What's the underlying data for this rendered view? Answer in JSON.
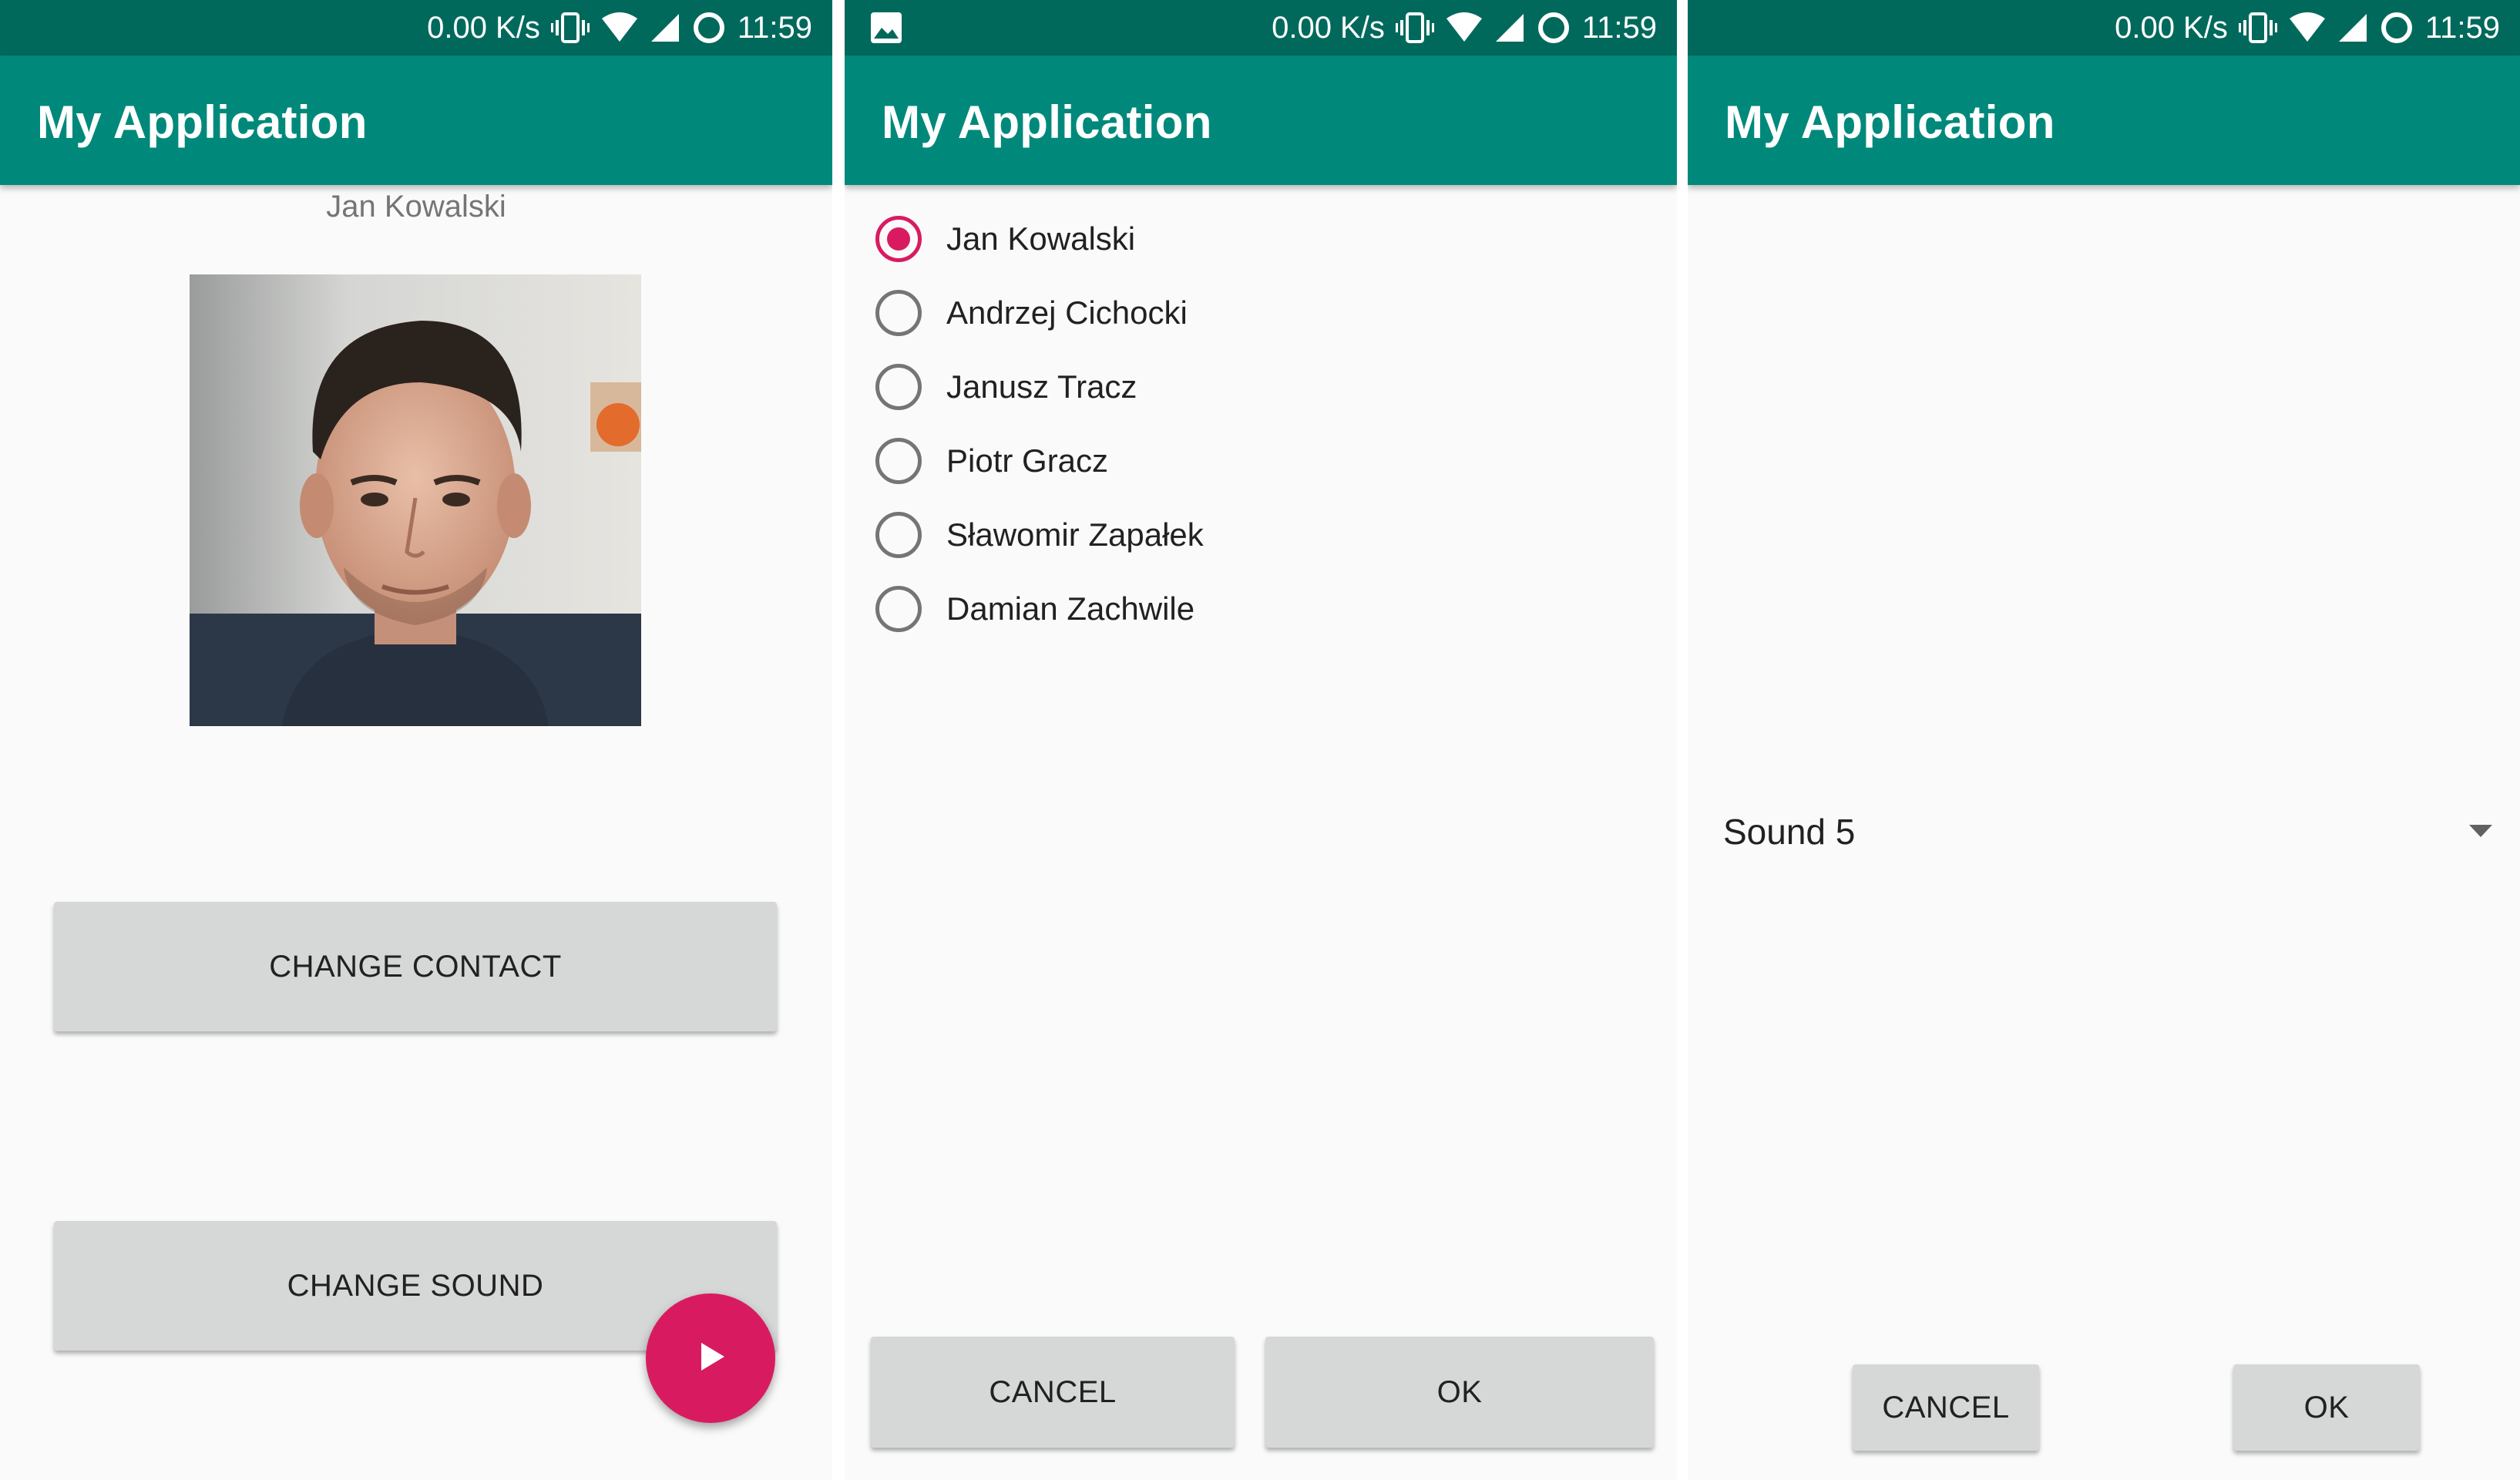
{
  "status_bar": {
    "speed": "0.00 K/s",
    "time": "11:59",
    "icons": [
      "vibrate-icon",
      "wifi-icon",
      "signal-icon",
      "sync-icon"
    ]
  },
  "screens": [
    {
      "app_title": "My Application",
      "contact_name": "Jan Kowalski",
      "change_contact_label": "CHANGE CONTACT",
      "change_sound_label": "CHANGE SOUND",
      "fab_icon": "play-icon"
    },
    {
      "app_title": "My Application",
      "status_left_icon": "image-icon",
      "contacts": [
        {
          "name": "Jan Kowalski",
          "selected": true
        },
        {
          "name": "Andrzej Cichocki",
          "selected": false
        },
        {
          "name": "Janusz Tracz",
          "selected": false
        },
        {
          "name": "Piotr Gracz",
          "selected": false
        },
        {
          "name": "Sławomir Zapałek",
          "selected": false
        },
        {
          "name": "Damian Zachwile",
          "selected": false
        }
      ],
      "cancel_label": "CANCEL",
      "ok_label": "OK"
    },
    {
      "app_title": "My Application",
      "sound_value": "Sound 5",
      "cancel_label": "CANCEL",
      "ok_label": "OK"
    }
  ],
  "colors": {
    "status_bar": "#00695c",
    "app_bar": "#00897b",
    "accent": "#d81b60",
    "button": "#d6d7d7",
    "background": "#fafafa"
  }
}
